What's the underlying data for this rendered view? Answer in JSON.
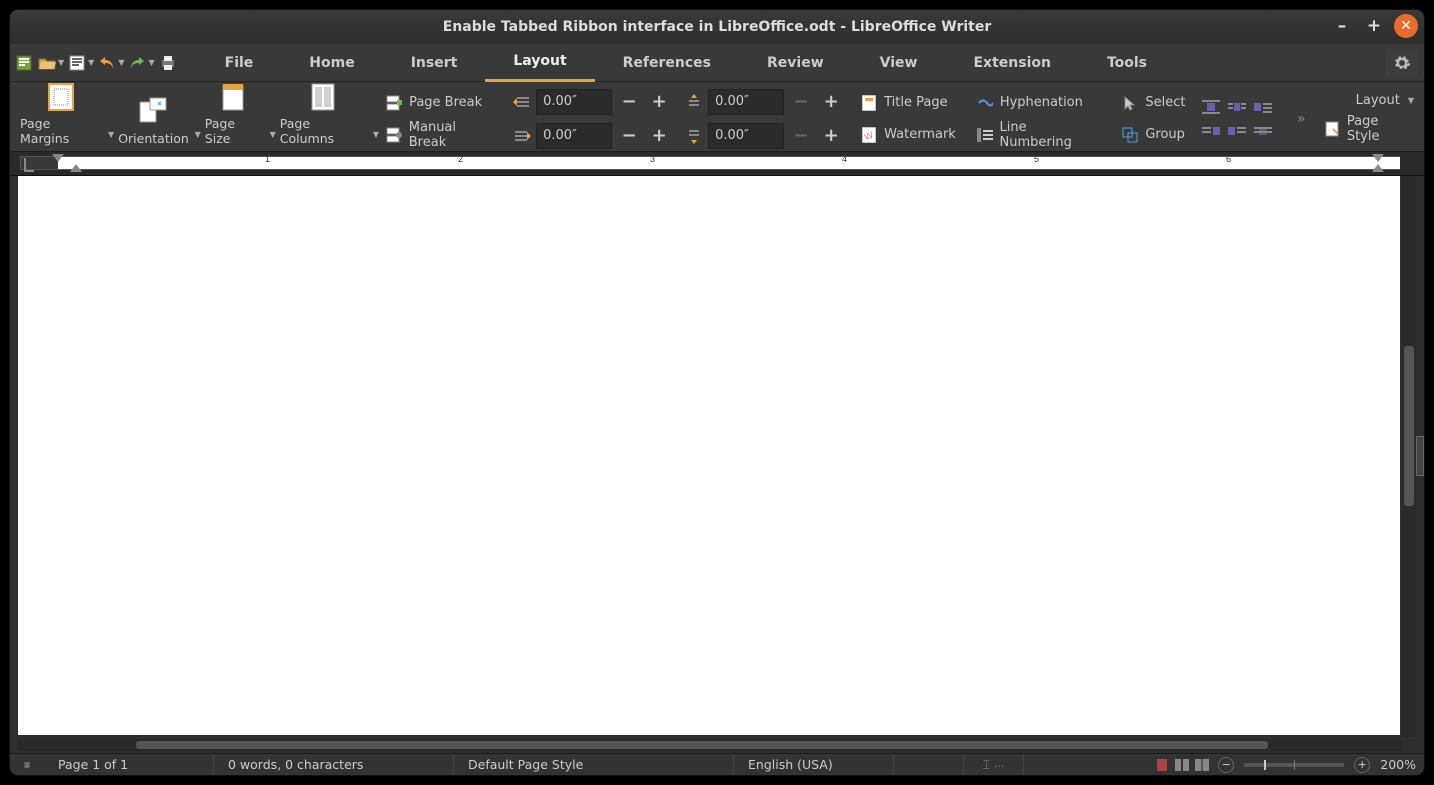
{
  "window": {
    "title": "Enable Tabbed Ribbon interface in LibreOffice.odt - LibreOffice Writer"
  },
  "tabs": {
    "file": "File",
    "home": "Home",
    "insert": "Insert",
    "layout": "Layout",
    "references": "References",
    "review": "Review",
    "view": "View",
    "extension": "Extension",
    "tools": "Tools",
    "active": "layout"
  },
  "ribbon": {
    "page_margins": "Page Margins",
    "orientation": "Orientation",
    "page_size": "Page Size",
    "page_columns": "Page Columns",
    "page_break": "Page Break",
    "manual_break": "Manual Break",
    "indent_left": "0.00″",
    "indent_right": "0.00″",
    "spacing_before": "0.00″",
    "spacing_after": "0.00″",
    "title_page": "Title Page",
    "watermark": "Watermark",
    "hyphenation": "Hyphenation",
    "line_numbering": "Line Numbering",
    "select": "Select",
    "group": "Group",
    "layout_menu": "Layout",
    "page_style": "Page Style"
  },
  "ruler": {
    "numbers": [
      "1",
      "2",
      "3",
      "4",
      "5",
      "6"
    ]
  },
  "status": {
    "page": "Page 1 of 1",
    "words": "0 words, 0 characters",
    "style": "Default Page Style",
    "lang": "English (USA)",
    "zoom": "200%"
  }
}
